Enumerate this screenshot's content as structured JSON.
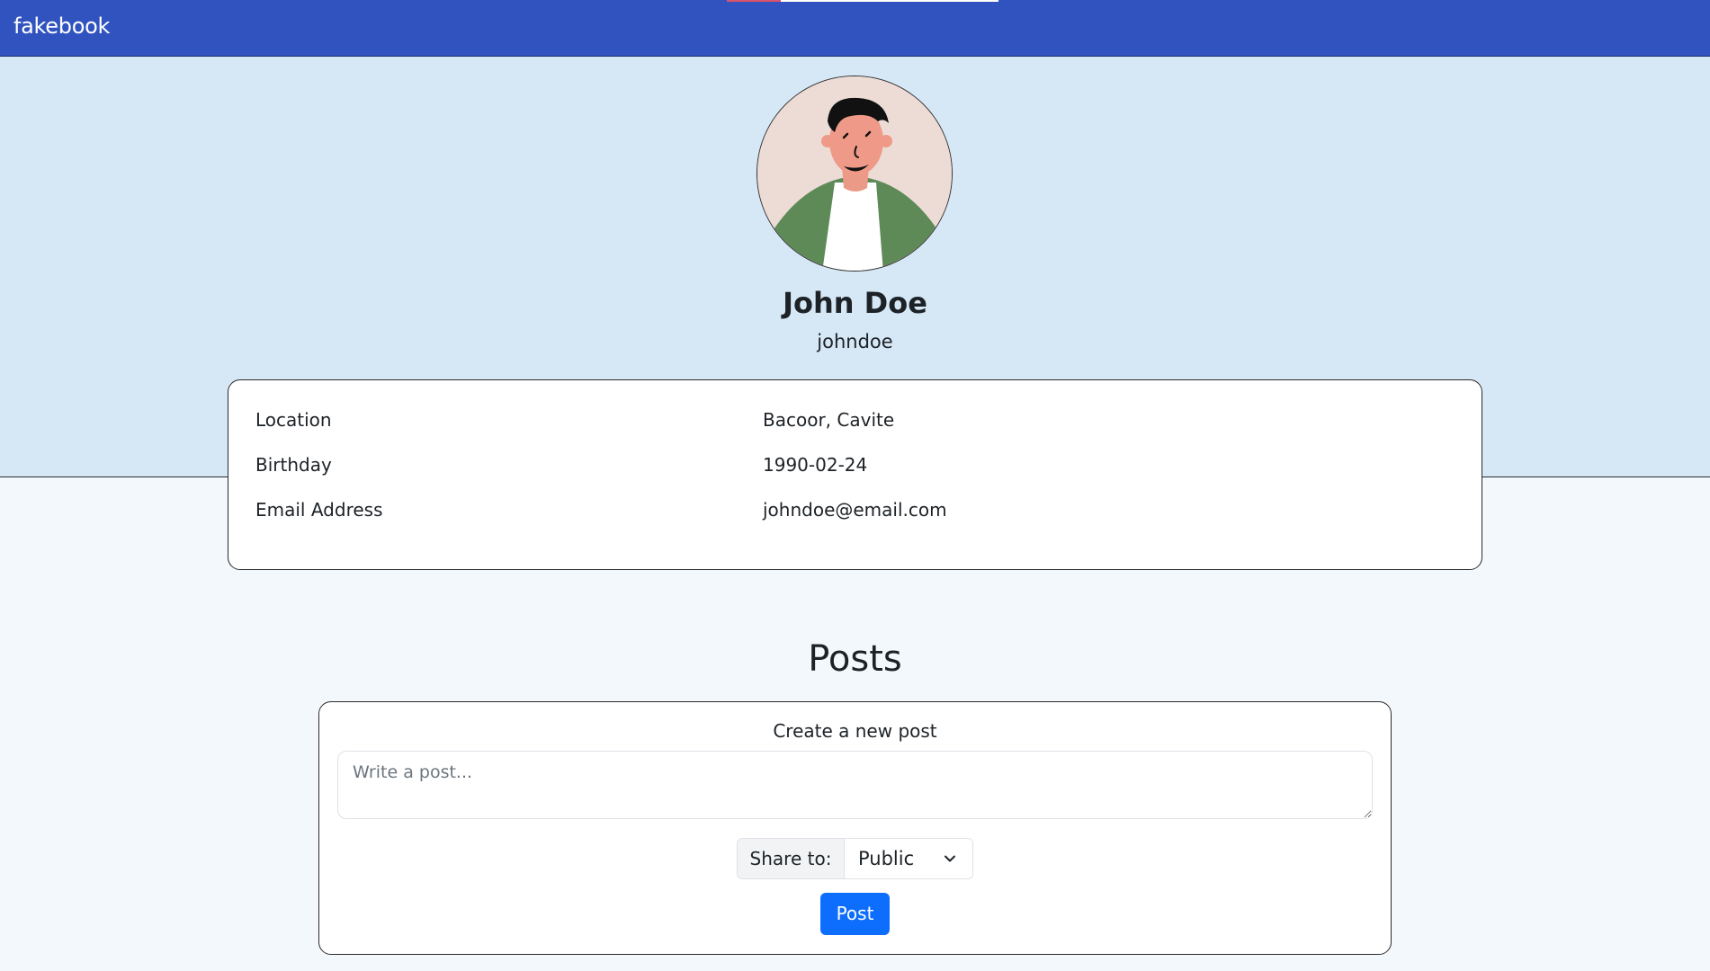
{
  "navbar": {
    "brand": "fakebook"
  },
  "profile": {
    "full_name": "John Doe",
    "username": "johndoe",
    "avatar_icon": "avatar-illustration-icon"
  },
  "info": {
    "rows": [
      {
        "label": "Location",
        "value": "Bacoor, Cavite"
      },
      {
        "label": "Birthday",
        "value": "1990-02-24"
      },
      {
        "label": "Email Address",
        "value": "johndoe@email.com"
      }
    ]
  },
  "posts": {
    "title": "Posts",
    "create": {
      "title": "Create a new post",
      "placeholder": "Write a post...",
      "value": "",
      "share_label": "Share to:",
      "share_selected": "Public",
      "post_button": "Post"
    }
  },
  "colors": {
    "navbar": "#3153bf",
    "cover": "#d6e7f6",
    "page_background": "#f3f8fc",
    "primary_button": "#0d6efd"
  }
}
